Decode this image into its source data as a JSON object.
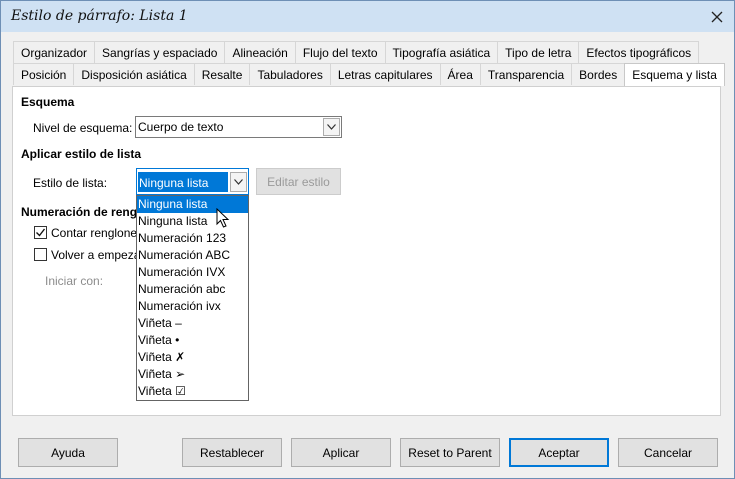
{
  "window": {
    "title": "Estilo de párrafo: Lista 1",
    "close_icon": "close-icon"
  },
  "tabs_row1": [
    "Organizador",
    "Sangrías y espaciado",
    "Alineación",
    "Flujo del texto",
    "Tipografía asiática",
    "Tipo de letra",
    "Efectos tipográficos"
  ],
  "tabs_row2": [
    "Posición",
    "Disposición asiática",
    "Resalte",
    "Tabuladores",
    "Letras capitulares",
    "Área",
    "Transparencia",
    "Bordes",
    "Esquema y lista"
  ],
  "active_tab": "Esquema y lista",
  "outline": {
    "heading": "Esquema",
    "level_label": "Nivel de esquema:",
    "level_value": "Cuerpo de texto"
  },
  "list_style": {
    "heading": "Aplicar estilo de lista",
    "style_label": "Estilo de lista:",
    "style_value": "Ninguna lista",
    "edit_button": "Editar estilo",
    "options": [
      "Ninguna lista",
      "Ninguna lista",
      "Numeración 123",
      "Numeración ABC",
      "Numeración IVX",
      "Numeración abc",
      "Numeración ivx",
      "Viñeta –",
      "Viñeta •",
      "Viñeta ✗",
      "Viñeta ➢",
      "Viñeta ☑"
    ],
    "selected_index": 0
  },
  "line_numbering": {
    "heading": "Numeración de renglones",
    "count_lines_label": "Contar renglones",
    "count_lines_checked": true,
    "restart_label": "Volver a empezar",
    "restart_checked": false,
    "start_with_label": "Iniciar con:"
  },
  "buttons": {
    "help": "Ayuda",
    "reset": "Restablecer",
    "apply": "Aplicar",
    "reset_parent": "Reset to Parent",
    "ok": "Aceptar",
    "cancel": "Cancelar"
  }
}
